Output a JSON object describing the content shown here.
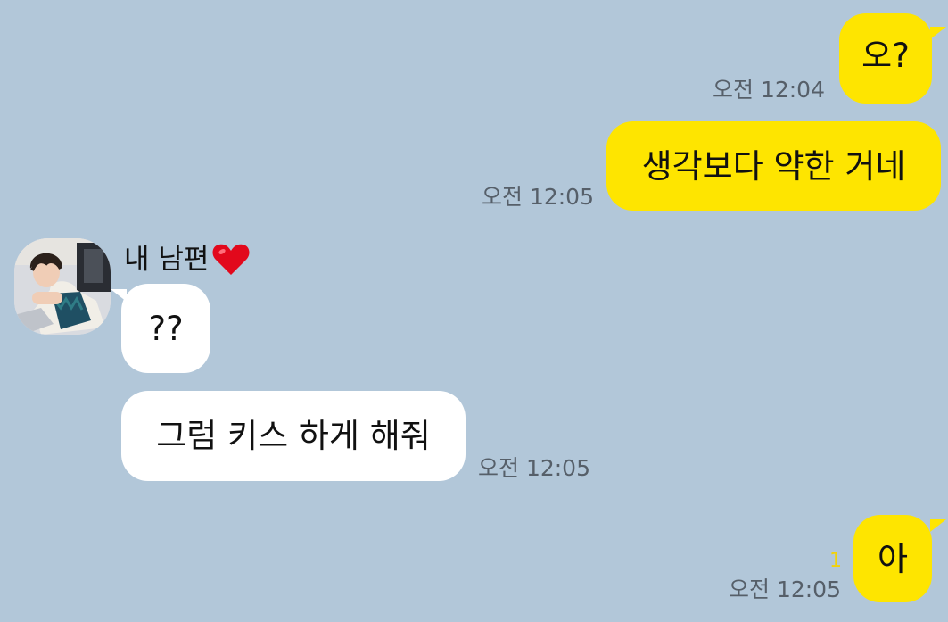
{
  "chat": {
    "colors": {
      "background": "#b2c7d9",
      "my_bubble": "#fee500",
      "their_bubble": "#ffffff",
      "unread": "#f2d20a",
      "time_text": "#565f69"
    },
    "sender": {
      "name": "내 남편",
      "name_icon": "heart-icon",
      "avatar_icon": "profile-photo"
    },
    "messages": [
      {
        "from": "me",
        "text": "오?",
        "time": "오전 12:04"
      },
      {
        "from": "me",
        "text": "생각보다 약한 거네",
        "time": "오전 12:05"
      },
      {
        "from": "them",
        "text": "??"
      },
      {
        "from": "them",
        "text": "그럼 키스 하게 해줘",
        "time": "오전 12:05"
      },
      {
        "from": "me",
        "text": "아",
        "time": "오전 12:05",
        "unread_count": "1"
      }
    ]
  }
}
